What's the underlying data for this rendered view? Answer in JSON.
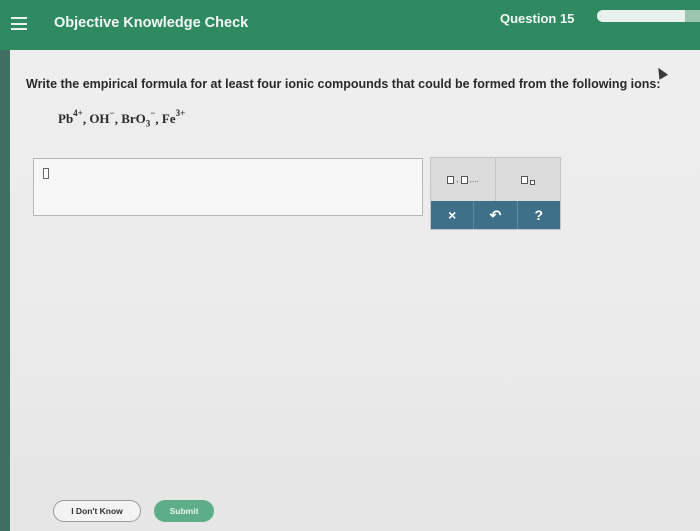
{
  "header": {
    "title": "Objective Knowledge Check",
    "question_label": "Question 15",
    "progress_fraction": 0.85
  },
  "question": {
    "prompt": "Write the empirical formula for at least four ionic compounds that could be formed from the following ions:",
    "ions": [
      {
        "base": "Pb",
        "sub": "",
        "sup": "4+",
        "sep": ", "
      },
      {
        "base": "OH",
        "sub": "",
        "sup": "−",
        "sep": ", "
      },
      {
        "base": "BrO",
        "sub": "3",
        "sup": "−",
        "sep": ", "
      },
      {
        "base": "Fe",
        "sub": "",
        "sup": "3+",
        "sep": ""
      }
    ]
  },
  "tools": {
    "clear_symbol": "×",
    "undo_symbol": "↶",
    "help_symbol": "?"
  },
  "footer": {
    "dont_know_label": "I Don't Know",
    "submit_label": "Submit"
  },
  "colors": {
    "header_green": "#2f8a62",
    "submit_green": "#5dae88",
    "tool_blue": "#3e7189"
  }
}
